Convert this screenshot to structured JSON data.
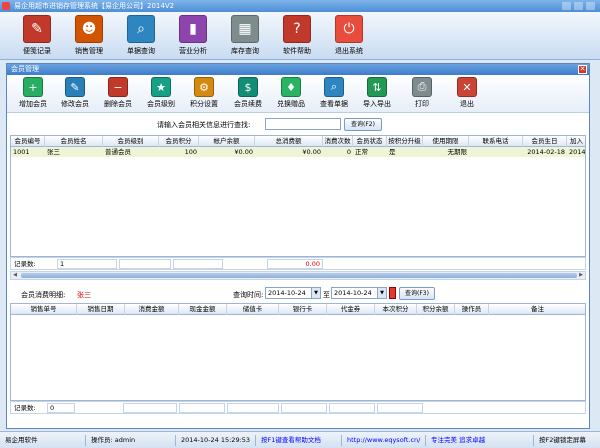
{
  "window": {
    "title": "易企用超市进销存管理系统【易企用公司】2014V2"
  },
  "main_toolbar": [
    {
      "label": "便笺记录",
      "icon": "notepad-icon",
      "color": "#c0392b",
      "glyph": "✎"
    },
    {
      "label": "销售管理",
      "icon": "people-icon",
      "color": "#d35400",
      "glyph": "☻"
    },
    {
      "label": "单据查询",
      "icon": "magnifier-icon",
      "color": "#2e86c1",
      "glyph": "⌕"
    },
    {
      "label": "营业分析",
      "icon": "bar-chart-icon",
      "color": "#8e44ad",
      "glyph": "▮"
    },
    {
      "label": "库存查询",
      "icon": "warehouse-icon",
      "color": "#7f8c8d",
      "glyph": "▦"
    },
    {
      "label": "软件帮助",
      "icon": "help-icon",
      "color": "#c0392b",
      "glyph": "?"
    },
    {
      "label": "退出系统",
      "icon": "power-icon",
      "color": "#e74c3c",
      "glyph": "⏻"
    }
  ],
  "dialog": {
    "title": "会员管理",
    "toolbar": [
      {
        "label": "增加会员",
        "icon": "add-member-icon",
        "color": "#27ae60",
        "glyph": "+"
      },
      {
        "label": "修改会员",
        "icon": "edit-member-icon",
        "color": "#2980b9",
        "glyph": "✎"
      },
      {
        "label": "删除会员",
        "icon": "delete-member-icon",
        "color": "#c0392b",
        "glyph": "−"
      },
      {
        "label": "会员级别",
        "icon": "level-icon",
        "color": "#16a085",
        "glyph": "★"
      },
      {
        "label": "积分设置",
        "icon": "points-icon",
        "color": "#d68910",
        "glyph": "⚙"
      },
      {
        "label": "会员续费",
        "icon": "renew-icon",
        "color": "#138d75",
        "glyph": "$"
      },
      {
        "label": "兑换赠品",
        "icon": "gift-icon",
        "color": "#28b463",
        "glyph": "♦"
      },
      {
        "label": "查看单据",
        "icon": "view-doc-icon",
        "color": "#2e86c1",
        "glyph": "⌕"
      },
      {
        "label": "导入导出",
        "icon": "import-export-icon",
        "color": "#229954",
        "glyph": "⇅"
      },
      {
        "label": "打印",
        "icon": "printer-icon",
        "color": "#7f8c8d",
        "glyph": "⎙"
      },
      {
        "label": "退出",
        "icon": "exit-icon",
        "color": "#cb4335",
        "glyph": "✕"
      }
    ],
    "search": {
      "label": "请输入会员相关信息进行查找:",
      "value": "",
      "button": "查询(F2)"
    },
    "member_table": {
      "headers": [
        "会员编号",
        "会员姓名",
        "会员级别",
        "会员积分",
        "帐户余额",
        "总消费额",
        "消费次数",
        "会员状态",
        "按积分升级",
        "使用期限",
        "联系电话",
        "会员生日",
        "加入"
      ],
      "rows": [
        [
          "1001",
          "张三",
          "普通会员",
          "100",
          "¥0.00",
          "¥0.00",
          "0",
          "正常",
          "是",
          "无期限",
          "",
          "2014-02-18",
          "2014-"
        ]
      ]
    },
    "member_footer": {
      "count_label": "记录数:",
      "count_value": "1",
      "total_value": "0.00"
    },
    "detail": {
      "label": "会员消费明细:",
      "member_name": "张三",
      "time_label": "查询时间:",
      "from_date": "2014-10-24",
      "to_label": "至",
      "to_date": "2014-10-24",
      "button": "查询(F3)"
    },
    "detail_table": {
      "headers": [
        "销售单号",
        "销售日期",
        "消费金额",
        "现金金额",
        "储值卡",
        "银行卡",
        "代金券",
        "本次积分",
        "积分余额",
        "操作员",
        "备注"
      ],
      "rows": []
    },
    "detail_footer": {
      "count_label": "记录数:",
      "count_value": "0"
    }
  },
  "statusbar": {
    "company": "易企用软件",
    "operator": "操作员: admin",
    "datetime": "2014-10-24 15:29:53",
    "help": "按F1键查看帮助文档",
    "url": "http://www.eqysoft.cn/",
    "slogan": "专注完美 追求卓越",
    "lock": "按F2键锁定屏幕"
  }
}
